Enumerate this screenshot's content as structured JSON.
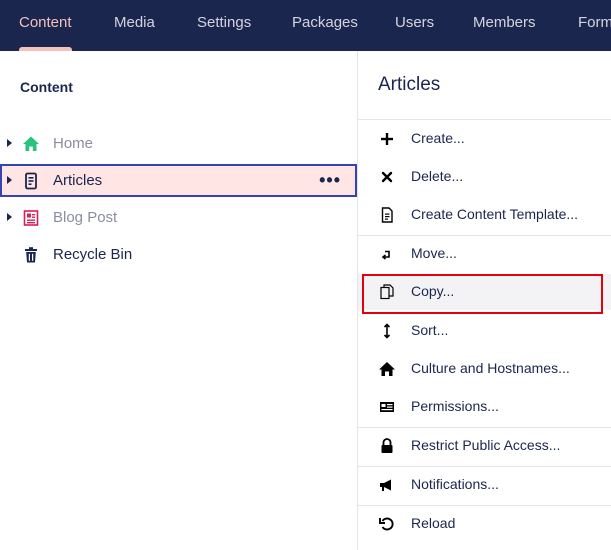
{
  "nav": {
    "tabs": [
      {
        "label": "Content",
        "active": true
      },
      {
        "label": "Media"
      },
      {
        "label": "Settings"
      },
      {
        "label": "Packages"
      },
      {
        "label": "Users"
      },
      {
        "label": "Members"
      },
      {
        "label": "Forms"
      }
    ]
  },
  "tree": {
    "title": "Content",
    "items": [
      {
        "label": "Home",
        "icon": "home-icon",
        "state": "unpublished"
      },
      {
        "label": "Articles",
        "icon": "document-list-icon",
        "state": "selected"
      },
      {
        "label": "Blog Post",
        "icon": "newspaper-icon",
        "state": "unpublished"
      },
      {
        "label": "Recycle Bin",
        "icon": "trash-icon"
      }
    ],
    "more_label": "•••"
  },
  "actions": {
    "title": "Articles",
    "items": [
      {
        "label": "Create...",
        "icon": "plus-icon"
      },
      {
        "label": "Delete...",
        "icon": "x-icon"
      },
      {
        "label": "Create Content Template...",
        "icon": "document-template-icon"
      },
      {
        "label": "Move...",
        "icon": "move-icon"
      },
      {
        "label": "Copy...",
        "icon": "copy-icon",
        "highlighted": true
      },
      {
        "label": "Sort...",
        "icon": "sort-icon"
      },
      {
        "label": "Culture and Hostnames...",
        "icon": "home-icon"
      },
      {
        "label": "Permissions...",
        "icon": "permissions-icon"
      },
      {
        "label": "Restrict Public Access...",
        "icon": "lock-icon"
      },
      {
        "label": "Notifications...",
        "icon": "megaphone-icon"
      },
      {
        "label": "Reload",
        "icon": "reload-icon"
      }
    ]
  },
  "colors": {
    "topbar": "#1b264f",
    "active_tab": "#f5c1bc",
    "selected_row_bg": "#ffe5e3",
    "selected_row_border": "#3544b1",
    "focus_outline": "#e3000f",
    "home_icon": "#2bc37c",
    "blog_icon": "#d42054"
  }
}
